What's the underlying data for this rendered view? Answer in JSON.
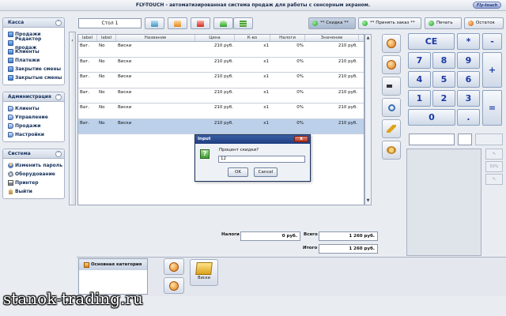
{
  "titlebar": {
    "title": "FLY-TOUCH - автоматизированная система продаж для работы с сенсорным экраном.",
    "logo_text": "Fly-touch"
  },
  "sidebar": {
    "kassa": {
      "title": "Касса",
      "items": [
        "Продажи",
        "Редактор продаж",
        "Клиенты",
        "Платежи",
        "Закрытие смены",
        "Закрытые смены"
      ]
    },
    "admin": {
      "title": "Администрация",
      "items": [
        "Клиенты",
        "Управление",
        "Продажи",
        "Настройки"
      ]
    },
    "system": {
      "title": "Система",
      "items": [
        "Изменить пароль",
        "Оборудование",
        "Принтер",
        "Выйти"
      ]
    }
  },
  "toolbar": {
    "table_name": "Стол 1",
    "discount_label": "** Скидка **",
    "accept_order_label": "** Принять заказ **",
    "print_label": "Печать",
    "remainder_label": "Остаток"
  },
  "order_table": {
    "headers": [
      "label",
      "label",
      "Название",
      "Цена",
      "К-во",
      "Налоги",
      "Значение"
    ],
    "rows": [
      [
        "Ват.",
        "No",
        "Виски",
        "210 руб.",
        "x1",
        "0%",
        "210 руб."
      ],
      [
        "Ват.",
        "No",
        "Виски",
        "210 руб.",
        "x1",
        "0%",
        "210 руб."
      ],
      [
        "Ват.",
        "No",
        "Виски",
        "210 руб.",
        "x1",
        "0%",
        "210 руб."
      ],
      [
        "Ват.",
        "No",
        "Виски",
        "210 руб.",
        "x1",
        "0%",
        "210 руб."
      ],
      [
        "Ват.",
        "No",
        "Виски",
        "210 руб.",
        "x1",
        "0%",
        "210 руб."
      ],
      [
        "Ват.",
        "No",
        "Виски",
        "210 руб.",
        "x1",
        "0%",
        "210 руб."
      ]
    ]
  },
  "numpad": {
    "keys": [
      "CE",
      "*",
      "-",
      "7",
      "8",
      "9",
      "+",
      "4",
      "5",
      "6",
      "1",
      "2",
      "3",
      "=",
      "0",
      "."
    ],
    "percent_button": "50%"
  },
  "totals": {
    "tax_label": "Налоги",
    "tax_value": "0 руб.",
    "sum_label": "Всего",
    "sum_value": "1 260 руб.",
    "total_label": "Итого",
    "total_value": "1 260 руб."
  },
  "categories": {
    "items": [
      "Основная категория"
    ]
  },
  "products": [
    {
      "name": "Виски"
    }
  ],
  "dialog": {
    "title": "Input",
    "close_glyph": "x",
    "prompt": "Процент скидки?",
    "value": "12",
    "ok_label": "OK",
    "cancel_label": "Cancel"
  },
  "watermark": "stanok-trading.ru"
}
